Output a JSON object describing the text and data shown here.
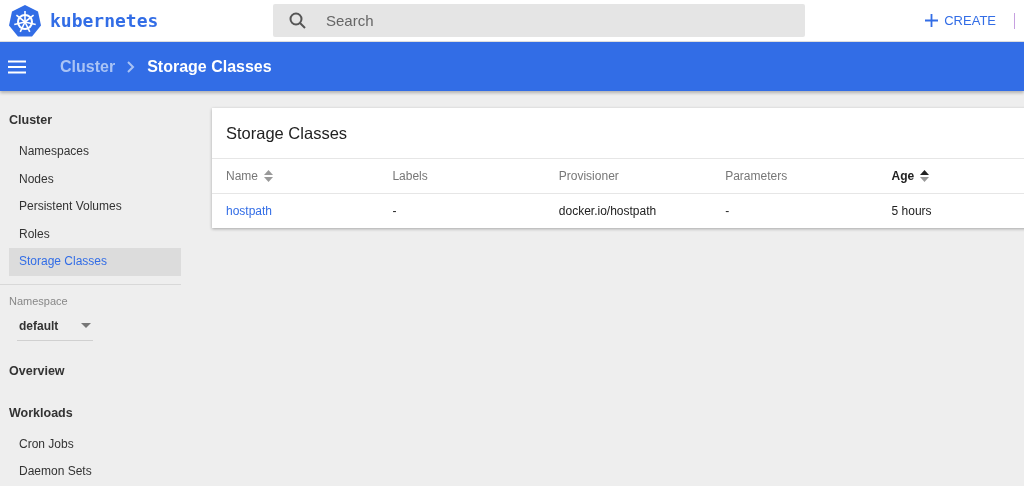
{
  "app": {
    "name": "kubernetes"
  },
  "search": {
    "placeholder": "Search"
  },
  "create_button": {
    "label": "CREATE"
  },
  "breadcrumb": [
    {
      "label": "Cluster",
      "selected": false
    },
    {
      "label": "Storage Classes",
      "selected": true
    }
  ],
  "sidebar": {
    "cluster": {
      "title": "Cluster",
      "items": [
        {
          "label": "Namespaces",
          "selected": false
        },
        {
          "label": "Nodes",
          "selected": false
        },
        {
          "label": "Persistent Volumes",
          "selected": false
        },
        {
          "label": "Roles",
          "selected": false
        },
        {
          "label": "Storage Classes",
          "selected": true
        }
      ]
    },
    "namespace": {
      "label": "Namespace",
      "value": "default"
    },
    "groups": [
      {
        "title": "Overview"
      },
      {
        "title": "Workloads",
        "items": [
          {
            "label": "Cron Jobs",
            "selected": false
          },
          {
            "label": "Daemon Sets",
            "selected": false
          }
        ]
      }
    ]
  },
  "card": {
    "title": "Storage Classes",
    "columns": [
      {
        "label": "Name",
        "sortable": true,
        "sorted": false
      },
      {
        "label": "Labels",
        "sortable": false,
        "sorted": false
      },
      {
        "label": "Provisioner",
        "sortable": false,
        "sorted": false
      },
      {
        "label": "Parameters",
        "sortable": false,
        "sorted": false
      },
      {
        "label": "Age",
        "sortable": true,
        "sorted": true
      }
    ],
    "rows": [
      {
        "cells": [
          "hostpath",
          "-",
          "docker.io/hostpath",
          "-",
          "5 hours"
        ]
      }
    ]
  }
}
